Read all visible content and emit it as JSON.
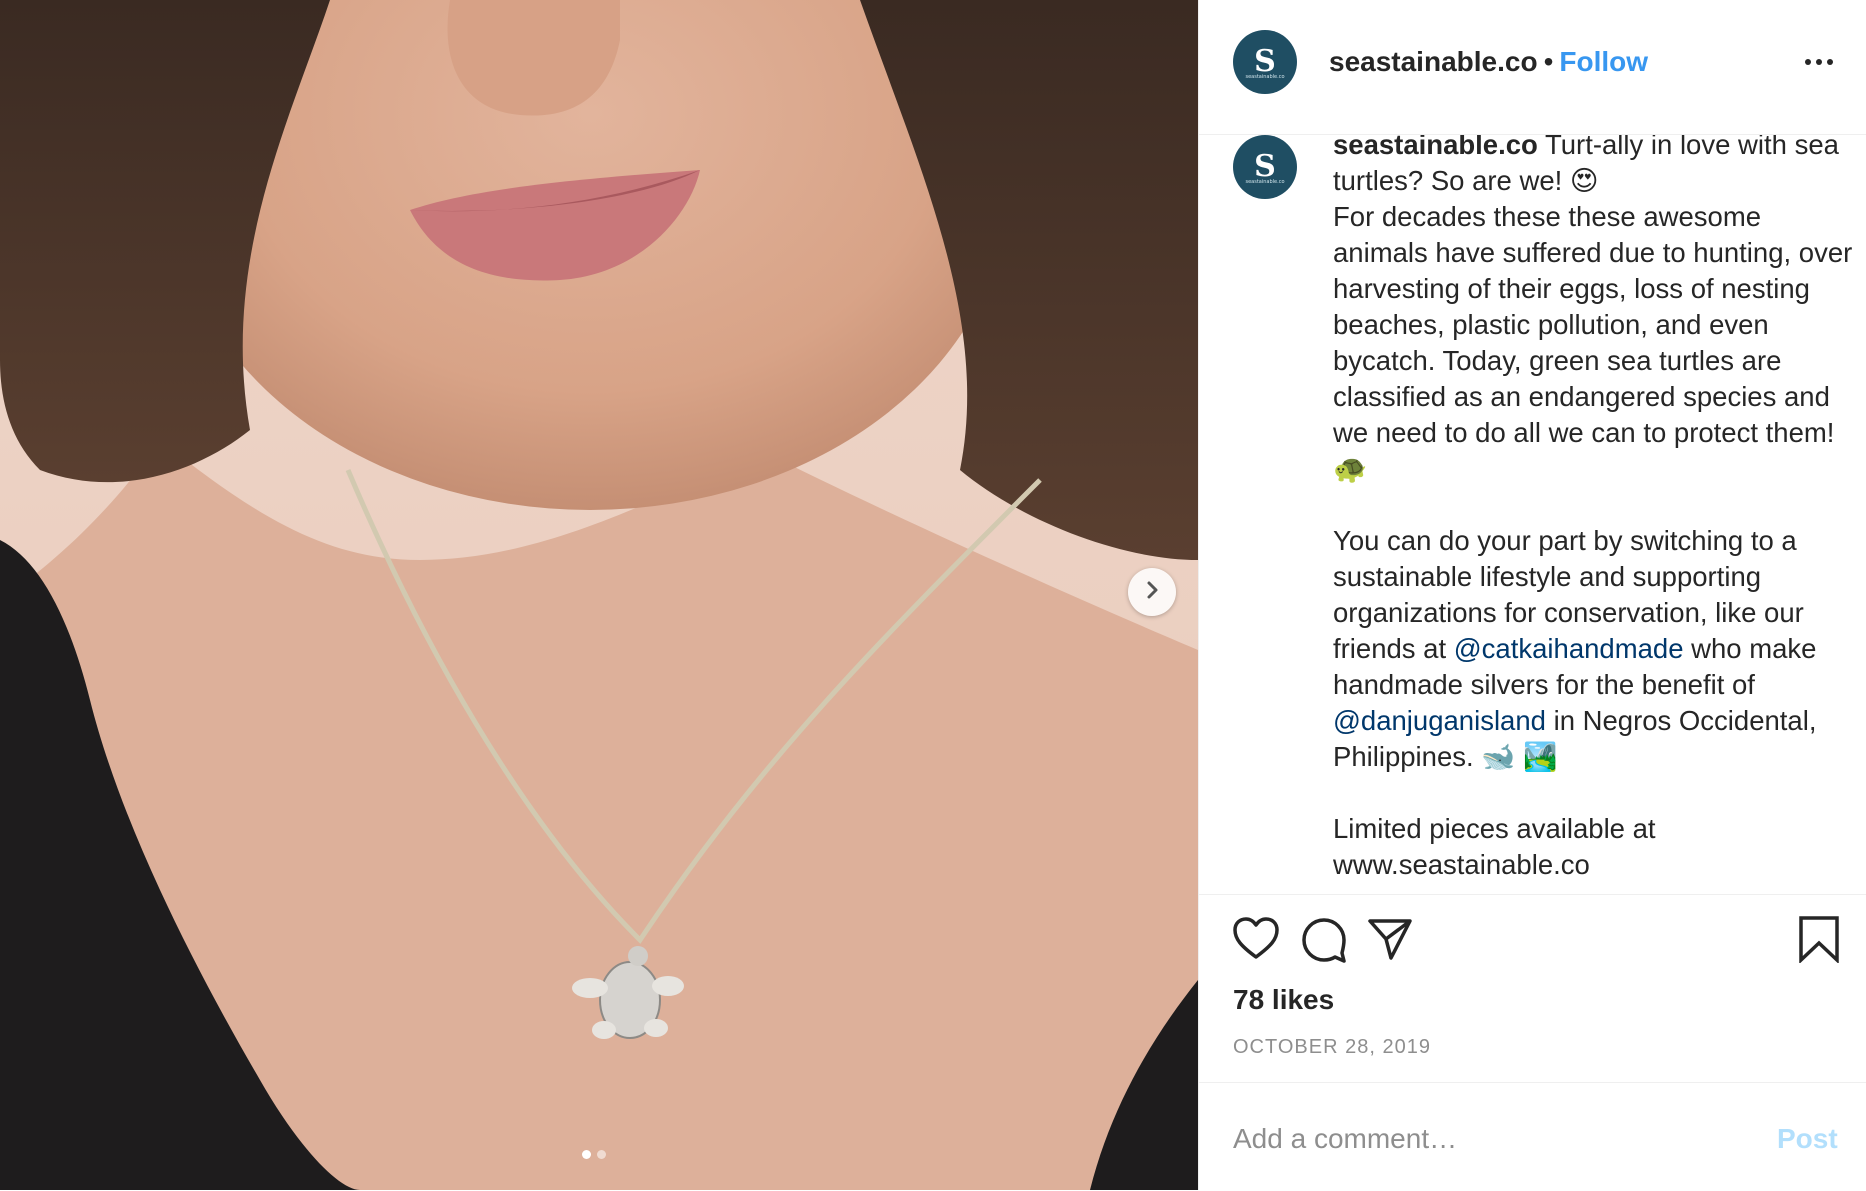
{
  "post": {
    "username": "seastainable.co",
    "separator": "•",
    "follow_label": "Follow",
    "avatar_letter": "S",
    "avatar_subtext": "seastainable.co"
  },
  "caption": {
    "username": "seastainable.co",
    "para1_a": " Turt-ally in love with sea turtles? So are we! 😍\nFor decades these these awesome animals have suffered due to hunting, over harvesting of their eggs, loss of nesting beaches, plastic pollution, and even bycatch. Today, green sea turtles are classified as an endangered species and we need to do all we can to protect them! 🐢\n\nYou can do your part by switching to a sustainable lifestyle and supporting organizations for conservation, like our friends at ",
    "mention1": "@catkaihandmade",
    "para2_a": " who make handmade silvers for the benefit of ",
    "mention2": "@danjuganisland",
    "para2_b": " in Negros Occidental, Philippines. 🐋 🏞️\n\nLimited pieces available at www.seastainable.co"
  },
  "stats": {
    "likes": "78 likes",
    "date": "OCTOBER 28, 2019"
  },
  "comment": {
    "placeholder": "Add a comment…",
    "post_label": "Post"
  },
  "carousel": {
    "current": 1,
    "total": 2
  },
  "icons": [
    "heart-icon",
    "comment-icon",
    "share-icon",
    "bookmark-icon",
    "more-icon",
    "chevron-right-icon"
  ],
  "colors": {
    "accent": "#3897f0",
    "mention": "#00376b",
    "avatar_bg": "#1f4e63",
    "post_disabled": "#b2dffc"
  }
}
